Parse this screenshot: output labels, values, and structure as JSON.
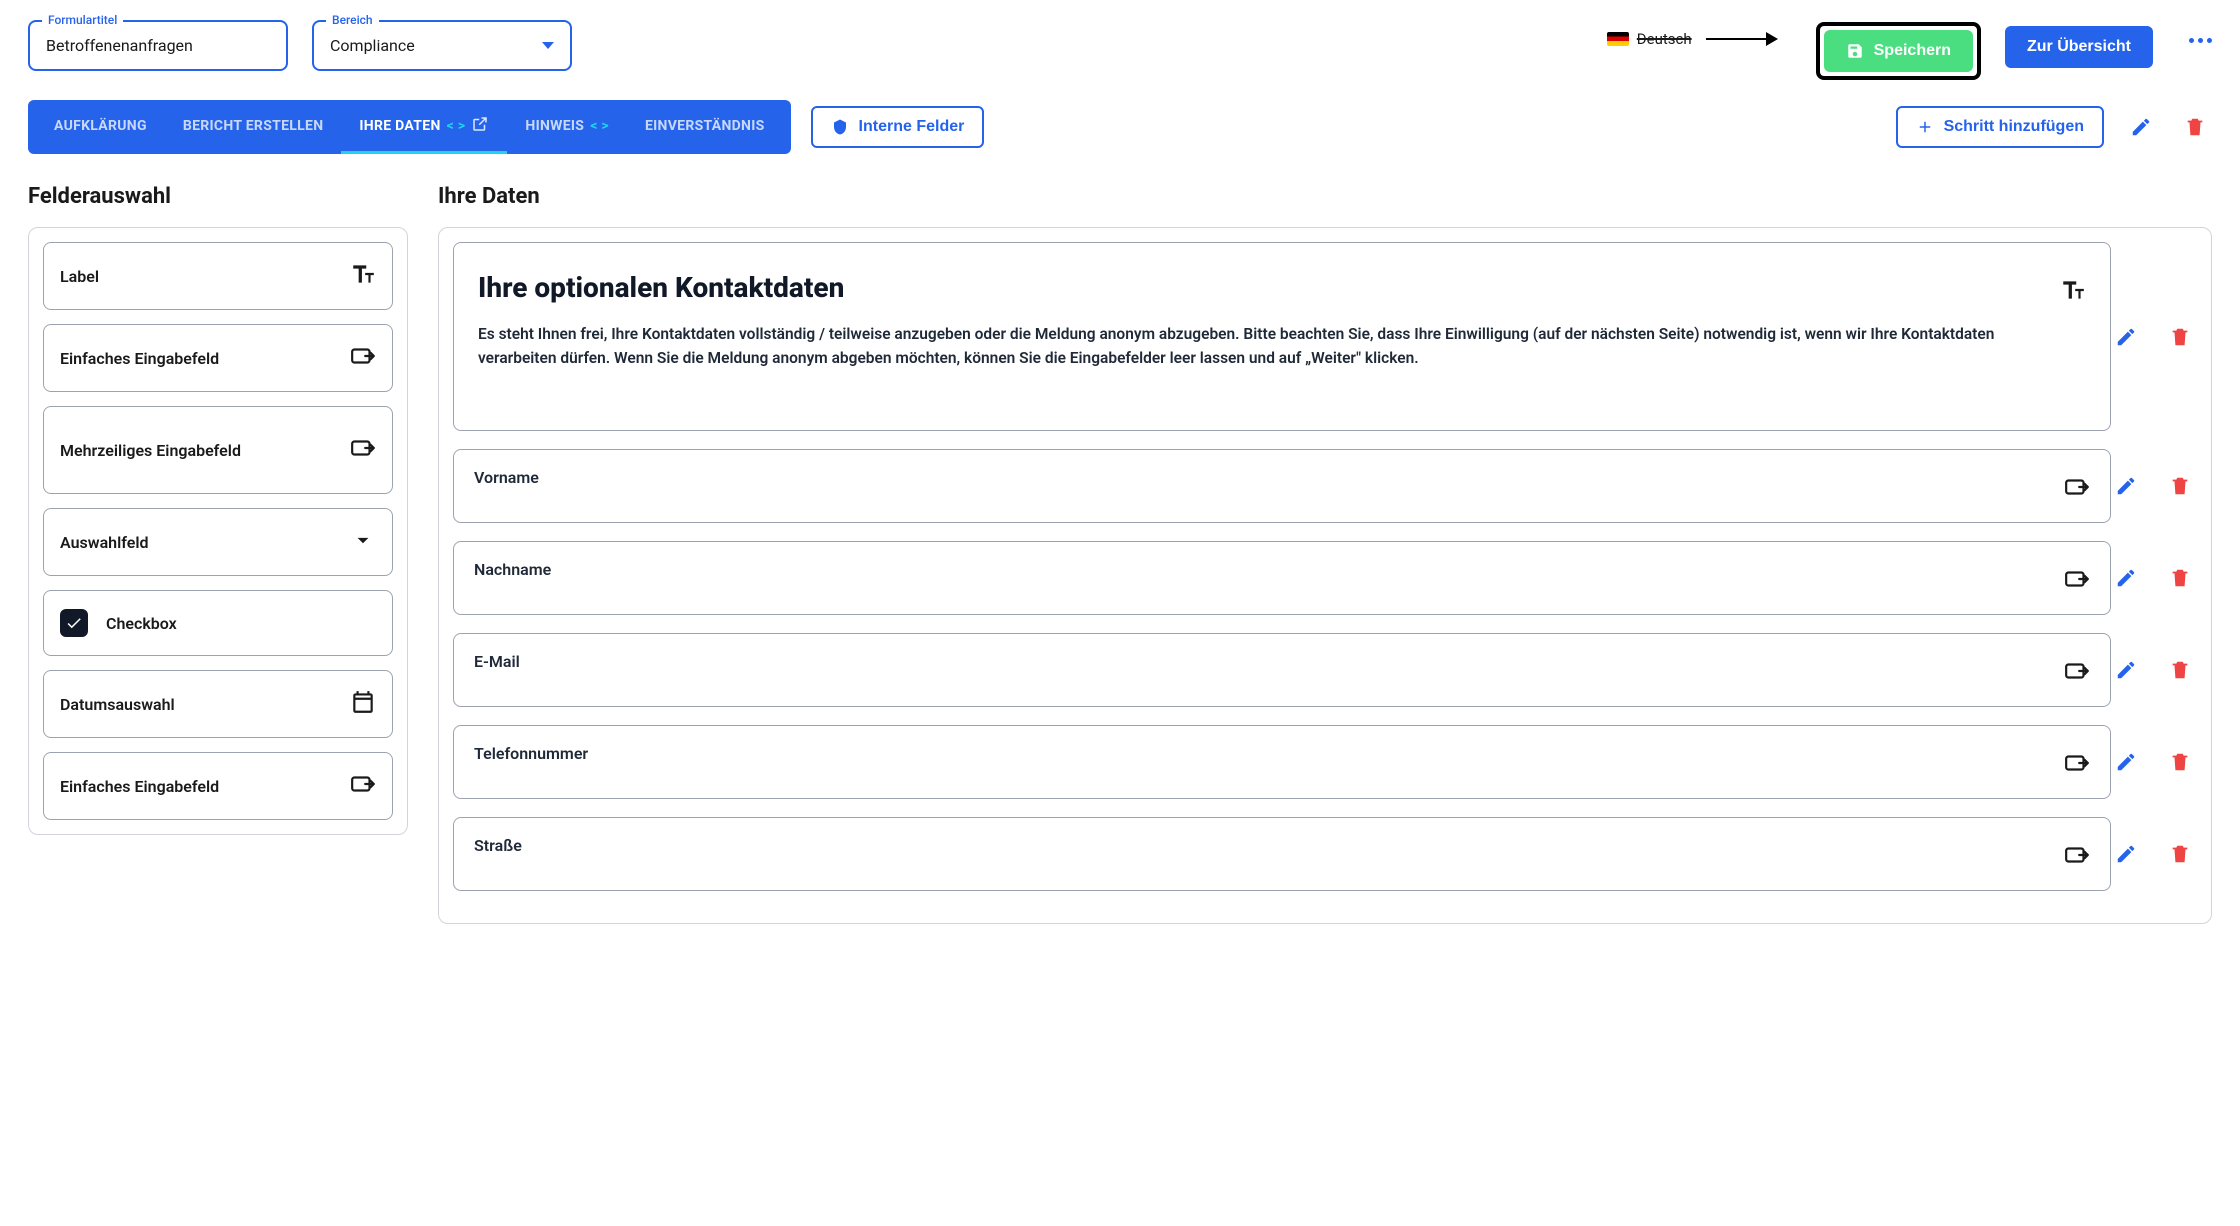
{
  "header": {
    "form_title_label": "Formulartitel",
    "form_title_value": "Betroffenenanfragen",
    "area_label": "Bereich",
    "area_value": "Compliance",
    "language": "Deutsch",
    "save_label": "Speichern",
    "overview_label": "Zur Übersicht"
  },
  "tabs": {
    "items": [
      {
        "label": "AUFKLÄRUNG",
        "active": false,
        "code": false,
        "ext": false
      },
      {
        "label": "BERICHT ERSTELLEN",
        "active": false,
        "code": false,
        "ext": false
      },
      {
        "label": "IHRE DATEN",
        "active": true,
        "code": true,
        "ext": true
      },
      {
        "label": "HINWEIS",
        "active": false,
        "code": true,
        "ext": false
      },
      {
        "label": "EINVERSTÄNDNIS",
        "active": false,
        "code": false,
        "ext": false
      }
    ],
    "internal_fields": "Interne Felder",
    "add_step": "Schritt hinzufügen"
  },
  "left": {
    "title": "Felderauswahl",
    "options": [
      {
        "label": "Label",
        "icon": "text"
      },
      {
        "label": "Einfaches Eingabefeld",
        "icon": "input"
      },
      {
        "label": "Mehrzeiliges Eingabefeld",
        "icon": "input",
        "tall": true
      },
      {
        "label": "Auswahlfeld",
        "icon": "chevron"
      },
      {
        "label": "Checkbox",
        "icon": "checkbox"
      },
      {
        "label": "Datumsauswahl",
        "icon": "calendar"
      },
      {
        "label": "Einfaches Eingabefeld",
        "icon": "input"
      }
    ]
  },
  "right": {
    "title": "Ihre Daten",
    "intro": {
      "heading": "Ihre optionalen Kontaktdaten",
      "body": "Es steht Ihnen frei, Ihre Kontaktdaten vollständig / teilweise anzugeben oder die Meldung anonym abzugeben. Bitte beachten Sie, dass Ihre Einwilligung (auf der nächsten Seite) notwendig ist, wenn wir Ihre Kontaktdaten verarbeiten dürfen. Wenn Sie die Meldung anonym abgeben möchten, können Sie die Eingabefelder leer lassen und auf „Weiter\" klicken."
    },
    "fields": [
      {
        "label": "Vorname"
      },
      {
        "label": "Nachname"
      },
      {
        "label": "E-Mail"
      },
      {
        "label": "Telefonnummer"
      },
      {
        "label": "Straße"
      }
    ]
  }
}
